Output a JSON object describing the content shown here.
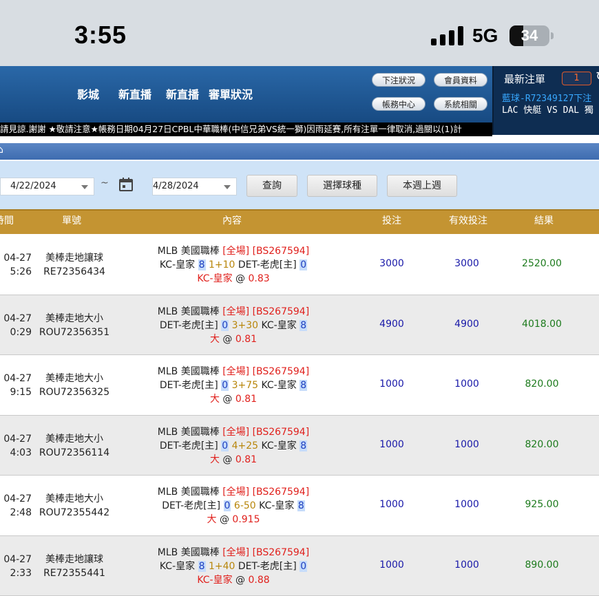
{
  "status_bar": {
    "time": "3:55",
    "network": "5G",
    "battery": "34",
    "battery_level_pct": 34
  },
  "nav": {
    "links": [
      "影城",
      "新直播",
      "新直播",
      "審單狀況"
    ],
    "pills": [
      "下注狀況",
      "會員資料",
      "帳務中心",
      "系統相關"
    ]
  },
  "latest_bets": {
    "title": "最新注單",
    "count": "1",
    "line1": "藍球-R72349127下注",
    "line2": "LAC 快艇 VS DAL 獨"
  },
  "marquee": "請見諒.謝謝 ★敬請注意★帳務日期04月27日CPBL中華職棒(中信兄弟VS統一獅)因雨延賽,所有注單一律取消,過關以(1)計",
  "filter": {
    "date_from": "4/22/2024",
    "separator": "~",
    "date_to": "4/28/2024",
    "btn_query": "查詢",
    "btn_select_sport": "選擇球種",
    "btn_week": "本週上週"
  },
  "table": {
    "headers": [
      "時間",
      "單號",
      "內容",
      "投注",
      "有效投注",
      "結果"
    ],
    "rows": [
      {
        "date": "04-27",
        "time": "5:26",
        "bet_type": "美棒走地讓球",
        "ticket": "RE72356434",
        "league": "MLB 美國職棒",
        "scope": "[全場]",
        "code": "[BS267594]",
        "team1": "KC-皇家",
        "score1": "8",
        "handicap": "1+10",
        "team2": "DET-老虎[主]",
        "score2": "0",
        "pick": "KC-皇家",
        "odds": "0.83",
        "stake": "3000",
        "valid": "3000",
        "result": "2520.00"
      },
      {
        "date": "04-27",
        "time": "0:29",
        "bet_type": "美棒走地大小",
        "ticket": "ROU72356351",
        "league": "MLB 美國職棒",
        "scope": "[全場]",
        "code": "[BS267594]",
        "team1": "DET-老虎[主]",
        "score1": "0",
        "handicap": "3+30",
        "team2": "KC-皇家",
        "score2": "8",
        "pick": "大",
        "odds": "0.81",
        "stake": "4900",
        "valid": "4900",
        "result": "4018.00"
      },
      {
        "date": "04-27",
        "time": "9:15",
        "bet_type": "美棒走地大小",
        "ticket": "ROU72356325",
        "league": "MLB 美國職棒",
        "scope": "[全場]",
        "code": "[BS267594]",
        "team1": "DET-老虎[主]",
        "score1": "0",
        "handicap": "3+75",
        "team2": "KC-皇家",
        "score2": "8",
        "pick": "大",
        "odds": "0.81",
        "stake": "1000",
        "valid": "1000",
        "result": "820.00"
      },
      {
        "date": "04-27",
        "time": "4:03",
        "bet_type": "美棒走地大小",
        "ticket": "ROU72356114",
        "league": "MLB 美國職棒",
        "scope": "[全場]",
        "code": "[BS267594]",
        "team1": "DET-老虎[主]",
        "score1": "0",
        "handicap": "4+25",
        "team2": "KC-皇家",
        "score2": "8",
        "pick": "大",
        "odds": "0.81",
        "stake": "1000",
        "valid": "1000",
        "result": "820.00"
      },
      {
        "date": "04-27",
        "time": "2:48",
        "bet_type": "美棒走地大小",
        "ticket": "ROU72355442",
        "league": "MLB 美國職棒",
        "scope": "[全場]",
        "code": "[BS267594]",
        "team1": "DET-老虎[主]",
        "score1": "0",
        "handicap": "6-50",
        "team2": "KC-皇家",
        "score2": "8",
        "pick": "大",
        "odds": "0.915",
        "stake": "1000",
        "valid": "1000",
        "result": "925.00"
      },
      {
        "date": "04-27",
        "time": "2:33",
        "bet_type": "美棒走地讓球",
        "ticket": "RE72355441",
        "league": "MLB 美國職棒",
        "scope": "[全場]",
        "code": "[BS267594]",
        "team1": "KC-皇家",
        "score1": "8",
        "handicap": "1+40",
        "team2": "DET-老虎[主]",
        "score2": "0",
        "pick": "KC-皇家",
        "odds": "0.88",
        "stake": "1000",
        "valid": "1000",
        "result": "890.00"
      }
    ]
  },
  "colors": {
    "nav_bg": "#174a82",
    "header_gold": "#c49432",
    "filter_bg": "#cfe3f7",
    "highlight_red": "#e0201c",
    "result_green": "#1c7a1c"
  }
}
